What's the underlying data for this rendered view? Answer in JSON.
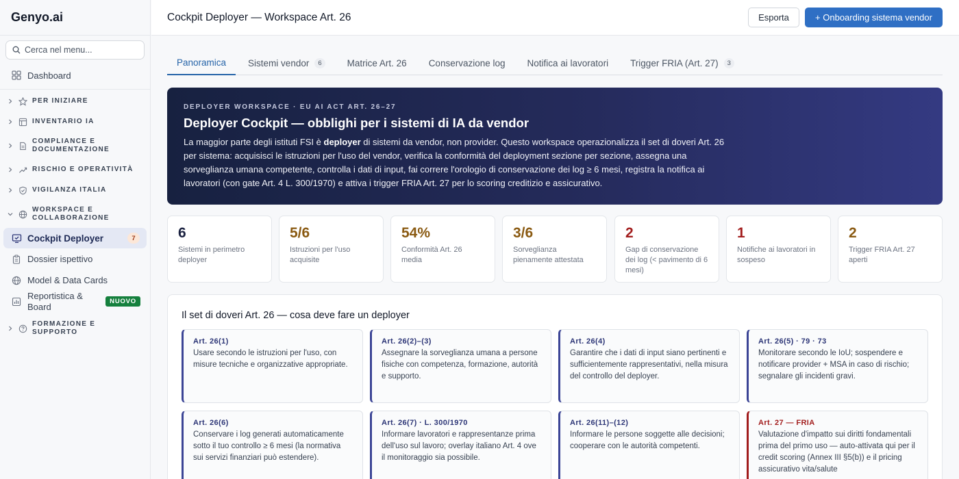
{
  "brand": "Genyo.ai",
  "search": {
    "placeholder": "Cerca nel menu..."
  },
  "sidebar": {
    "dashboard": "Dashboard",
    "groups": [
      {
        "label": "PER INIZIARE",
        "icon": "star-icon"
      },
      {
        "label": "INVENTARIO IA",
        "icon": "table-icon"
      },
      {
        "label": "COMPLIANCE E DOCUMENTAZIONE",
        "icon": "document-icon"
      },
      {
        "label": "RISCHIO E OPERATIVITÀ",
        "icon": "trend-icon"
      },
      {
        "label": "VIGILANZA ITALIA",
        "icon": "shield-icon"
      },
      {
        "label": "WORKSPACE E COLLABORAZIONE",
        "icon": "globe-icon"
      },
      {
        "label": "FORMAZIONE E SUPPORTO",
        "icon": "help-icon"
      }
    ],
    "items": [
      {
        "label": "Cockpit Deployer",
        "badge": "7"
      },
      {
        "label": "Dossier ispettivo"
      },
      {
        "label": "Model & Data Cards"
      },
      {
        "label": "Reportistica & Board",
        "badge": "NUOVO"
      }
    ]
  },
  "header": {
    "title": "Cockpit Deployer — Workspace Art. 26",
    "export_label": "Esporta",
    "primary_label": "+ Onboarding sistema vendor"
  },
  "tabs": [
    {
      "label": "Panoramica"
    },
    {
      "label": "Sistemi vendor",
      "count": "6"
    },
    {
      "label": "Matrice Art. 26"
    },
    {
      "label": "Conservazione log"
    },
    {
      "label": "Notifica ai lavoratori"
    },
    {
      "label": "Trigger FRIA (Art. 27)",
      "count": "3"
    }
  ],
  "hero": {
    "eyebrow": "DEPLOYER WORKSPACE · EU AI ACT ART. 26–27",
    "title": "Deployer Cockpit — obblighi per i sistemi di IA da vendor",
    "body_pre": "La maggior parte degli istituti FSI è ",
    "body_bold": "deployer",
    "body_post": " di sistemi da vendor, non provider. Questo workspace operazionalizza il set di doveri Art. 26 per sistema: acquisisci le istruzioni per l'uso del vendor, verifica la conformità del deployment sezione per sezione, assegna una sorveglianza umana competente, controlla i dati di input, fai correre l'orologio di conservazione dei log ≥ 6 mesi, registra la notifica ai lavoratori (con gate Art. 4 L. 300/1970) e attiva i trigger FRIA Art. 27 per lo scoring creditizio e assicurativo."
  },
  "stats": [
    {
      "value": "6",
      "label": "Sistemi in perimetro deployer",
      "tone": "dark"
    },
    {
      "value": "5/6",
      "label": "Istruzioni per l'uso acquisite",
      "tone": "amber"
    },
    {
      "value": "54%",
      "label": "Conformità Art. 26 media",
      "tone": "amber"
    },
    {
      "value": "3/6",
      "label": "Sorveglianza pienamente attestata",
      "tone": "amber"
    },
    {
      "value": "2",
      "label": "Gap di conservazione dei log (< pavimento di 6 mesi)",
      "tone": "red"
    },
    {
      "value": "1",
      "label": "Notifiche ai lavoratori in sospeso",
      "tone": "red"
    },
    {
      "value": "2",
      "label": "Trigger FRIA Art. 27 aperti",
      "tone": "amber"
    }
  ],
  "duties": {
    "title": "Il set di doveri Art. 26 — cosa deve fare un deployer",
    "cards": [
      {
        "art": "Art. 26(1)",
        "text": "Usare secondo le istruzioni per l'uso, con misure tecniche e organizzative appropriate."
      },
      {
        "art": "Art. 26(2)–(3)",
        "text": "Assegnare la sorveglianza umana a persone fisiche con competenza, formazione, autorità e supporto."
      },
      {
        "art": "Art. 26(4)",
        "text": "Garantire che i dati di input siano pertinenti e sufficientemente rappresentativi, nella misura del controllo del deployer."
      },
      {
        "art": "Art. 26(5) · 79 · 73",
        "text": "Monitorare secondo le IoU; sospendere e notificare provider + MSA in caso di rischio; segnalare gli incidenti gravi."
      },
      {
        "art": "Art. 26(6)",
        "text": "Conservare i log generati automaticamente sotto il tuo controllo ≥ 6 mesi (la normativa sui servizi finanziari può estendere)."
      },
      {
        "art": "Art. 26(7) · L. 300/1970",
        "text": "Informare lavoratori e rappresentanze prima dell'uso sul lavoro; overlay italiano Art. 4 ove il monitoraggio sia possibile."
      },
      {
        "art": "Art. 26(11)–(12)",
        "text": "Informare le persone soggette alle decisioni; cooperare con le autorità competenti."
      },
      {
        "art": "Art. 27 — FRIA",
        "text": "Valutazione d'impatto sui diritti fondamentali prima del primo uso — auto-attivata qui per il credit scoring (Annex III §5(b)) e il pricing assicurativo vita/salute"
      }
    ]
  }
}
